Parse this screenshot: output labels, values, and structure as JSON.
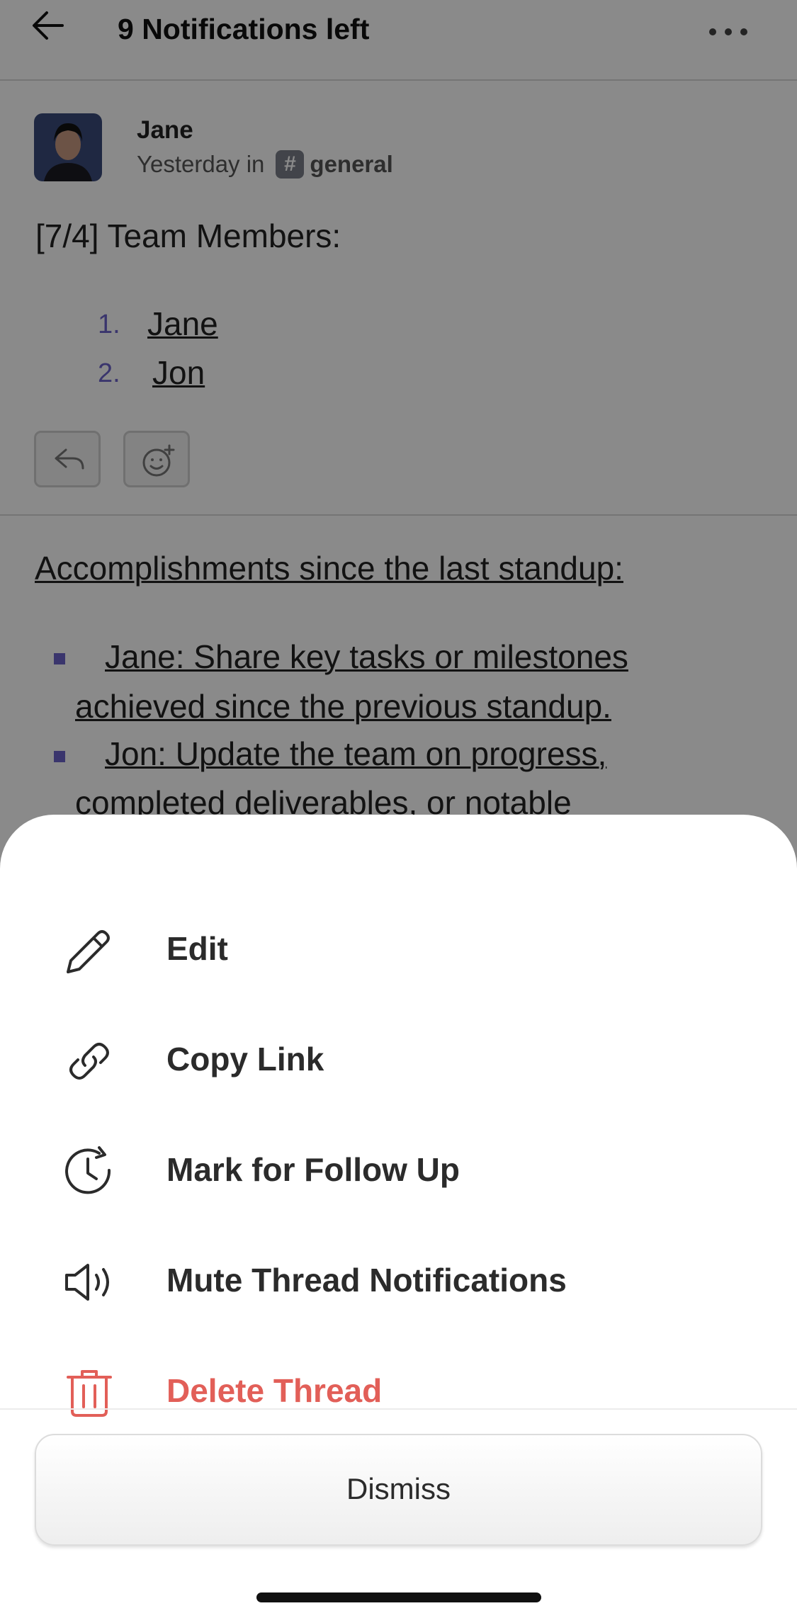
{
  "header": {
    "title": "9 Notifications left"
  },
  "post": {
    "author": "Jane",
    "time": "Yesterday in",
    "channel_symbol": "#",
    "channel": "general",
    "title": "[7/4] Team Members:",
    "members": [
      {
        "num": "1.",
        "name": "Jane"
      },
      {
        "num": "2.",
        "name": "Jon"
      }
    ],
    "section_heading": "Accomplishments since the last standup:",
    "bullets": [
      {
        "line1": "Jane: Share key tasks or milestones",
        "line2": "achieved since the previous standup."
      },
      {
        "line1": "Jon: Update the team on progress,",
        "line2": "completed deliverables, or notable"
      }
    ]
  },
  "menu": {
    "items": [
      {
        "label": "Edit",
        "icon": "pencil-icon"
      },
      {
        "label": "Copy Link",
        "icon": "link-icon"
      },
      {
        "label": "Mark for Follow Up",
        "icon": "clock-icon"
      },
      {
        "label": "Mute Thread Notifications",
        "icon": "speaker-icon"
      },
      {
        "label": "Delete Thread",
        "icon": "trash-icon",
        "color": "#e25f58"
      }
    ],
    "dismiss_label": "Dismiss"
  },
  "colors": {
    "accent": "#6b63c9",
    "danger": "#e25f58"
  }
}
